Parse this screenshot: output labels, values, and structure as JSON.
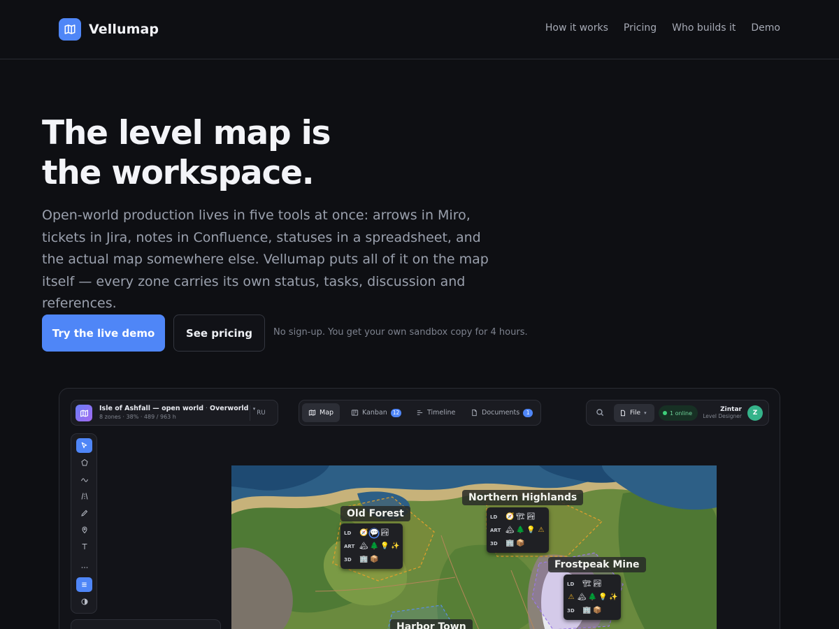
{
  "nav": {
    "brand": "Vellumap",
    "links": [
      "How it works",
      "Pricing",
      "Who builds it",
      "Demo"
    ]
  },
  "hero": {
    "title_line1": "The level map is",
    "title_line2": "the workspace.",
    "subtitle": "Open-world production lives in five tools at once: arrows in Miro, tickets in Jira, notes in Confluence, statuses in a spreadsheet, and the actual map somewhere else. Vellumap puts all of it on the map itself — every zone carries its own status, tasks, discussion and references.",
    "cta_primary": "Try the live demo",
    "cta_secondary": "See pricing",
    "cta_note": "No sign-up. You get your own sandbox copy for 4 hours."
  },
  "app": {
    "project": {
      "name": "Isle of Ashfall — open world",
      "layer": "Overworld",
      "meta": "8 zones · 38% · 489 / 963 h",
      "lang": "RU"
    },
    "tabs": [
      {
        "label": "Map",
        "badge": null
      },
      {
        "label": "Kanban",
        "badge": "12"
      },
      {
        "label": "Timeline",
        "badge": null
      },
      {
        "label": "Documents",
        "badge": "1"
      }
    ],
    "file_label": "File",
    "online": "1 online",
    "user": {
      "name": "Zintar",
      "role": "Level Designer",
      "initial": "Z"
    },
    "zones": [
      {
        "name": "Old Forest"
      },
      {
        "name": "Northern Highlands"
      },
      {
        "name": "Frostpeak Mine"
      },
      {
        "name": "Harbor Town"
      }
    ],
    "row_tags": {
      "ld": "LD",
      "art": "ART",
      "threed": "3D"
    },
    "accent": "#4f86f7"
  }
}
